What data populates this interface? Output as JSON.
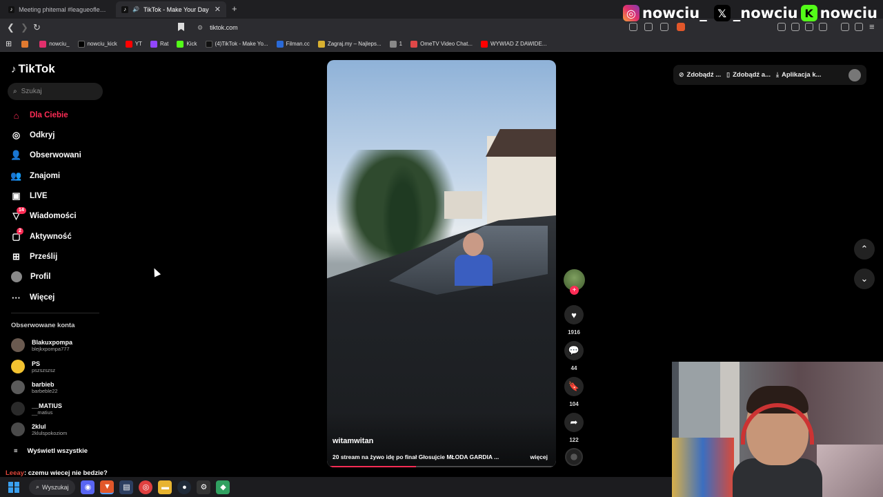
{
  "browser": {
    "tabs": [
      {
        "title": "Meeting phitemal #leagueoflegends"
      },
      {
        "title": "TikTok - Make Your Day"
      }
    ],
    "url": "tiktok.com",
    "bookmarks": [
      {
        "label": "",
        "color": "#e07a30"
      },
      {
        "label": "nowciu_",
        "color": "#e1306c"
      },
      {
        "label": "nowciu_kick",
        "color": "#000000"
      },
      {
        "label": "YT",
        "color": "#ff0000"
      },
      {
        "label": "Rat",
        "color": "#9146ff"
      },
      {
        "label": "Kick",
        "color": "#53fc18"
      },
      {
        "label": "(4)TikTok - Make Yo...",
        "color": "#111111"
      },
      {
        "label": "Filman.cc",
        "color": "#2a6ad8"
      },
      {
        "label": "Zagraj.my – Najleps...",
        "color": "#d8b030"
      },
      {
        "label": "1",
        "color": "#888888"
      },
      {
        "label": "OmeTV Video Chat...",
        "color": "#e04848"
      },
      {
        "label": "WYWIAD Z DAWIDE...",
        "color": "#ff0000"
      }
    ]
  },
  "overlay_social": [
    {
      "icon": "instagram-icon",
      "text": "nowciu_"
    },
    {
      "icon": "x-icon",
      "text": "_nowciu"
    },
    {
      "icon": "kick-icon",
      "text": "nowciu"
    }
  ],
  "tiktok": {
    "logo": "TikTok",
    "search_placeholder": "Szukaj",
    "nav": [
      {
        "label": "Dla Ciebie",
        "icon": "home-icon",
        "active": true
      },
      {
        "label": "Odkryj",
        "icon": "compass-icon"
      },
      {
        "label": "Obserwowani",
        "icon": "following-icon"
      },
      {
        "label": "Znajomi",
        "icon": "friends-icon"
      },
      {
        "label": "LIVE",
        "icon": "live-icon"
      },
      {
        "label": "Wiadomości",
        "icon": "messages-icon",
        "badge": "14"
      },
      {
        "label": "Aktywność",
        "icon": "activity-icon",
        "badge": "2"
      },
      {
        "label": "Prześlij",
        "icon": "upload-icon"
      },
      {
        "label": "Profil",
        "icon": "profile-icon"
      },
      {
        "label": "Więcej",
        "icon": "more-icon"
      }
    ],
    "followed_title": "Obserwowane konta",
    "followed": [
      {
        "name": "Blakuxpompa",
        "handle": "blejkxpompa777"
      },
      {
        "name": "PS",
        "handle": "pszszszsz"
      },
      {
        "name": "barbieb",
        "handle": "barbeble22"
      },
      {
        "name": "__MATIUS",
        "handle": "__matius"
      },
      {
        "name": "2klul",
        "handle": "2klulspokoziom"
      }
    ],
    "show_all": "Wyświetl wszystkie",
    "video": {
      "author": "witamwitan",
      "description": "20 stream na żywo idę po finał Głosujcie MŁODA GARDIA ...",
      "more": "więcej",
      "progress": 0.39
    },
    "actions": {
      "likes": "1916",
      "comments": "44",
      "saves": "104",
      "shares": "122"
    },
    "top_buttons": [
      "Zdobądź ...",
      "Zdobądź a...",
      "Aplikacja k..."
    ]
  },
  "stream_chat": {
    "user": "Leeay",
    "message": ": czemu wiecej nie bedzie?"
  },
  "taskbar": {
    "search_label": "Wyszukaj"
  }
}
